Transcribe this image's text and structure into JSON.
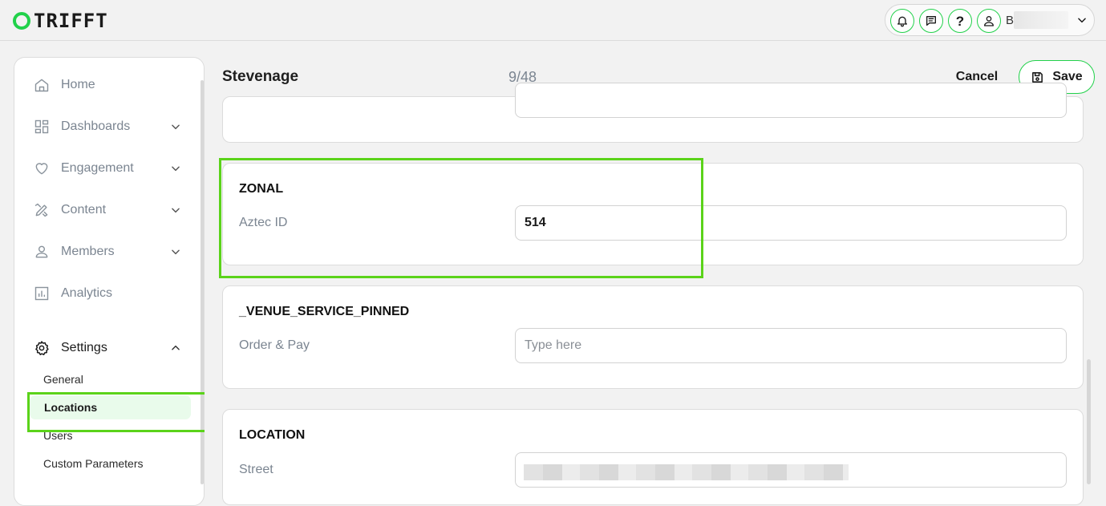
{
  "app": {
    "logo_text": "TRIFFT"
  },
  "header_tools": {
    "icons": [
      "bell-icon",
      "chat-icon",
      "help-icon",
      "user-icon",
      "chevron-down-icon"
    ],
    "help_glyph": "?",
    "user_initial": "B"
  },
  "sidebar": {
    "items": [
      {
        "label": "Home",
        "icon": "home-icon",
        "expandable": false
      },
      {
        "label": "Dashboards",
        "icon": "dashboard-icon",
        "expandable": true
      },
      {
        "label": "Engagement",
        "icon": "heart-icon",
        "expandable": true
      },
      {
        "label": "Content",
        "icon": "pencil-ruler-icon",
        "expandable": true
      },
      {
        "label": "Members",
        "icon": "person-icon",
        "expandable": true
      },
      {
        "label": "Analytics",
        "icon": "chart-icon",
        "expandable": false
      },
      {
        "label": "Settings",
        "icon": "gear-icon",
        "expandable": true,
        "expanded": true
      }
    ],
    "settings_sub": [
      "General",
      "Locations",
      "Users",
      "Custom Parameters"
    ],
    "selected_sub": "Locations"
  },
  "header": {
    "title": "Stevenage",
    "counter": "9/48",
    "cancel_label": "Cancel",
    "save_label": "Save"
  },
  "sections": [
    {
      "title": "ZONAL",
      "fields": [
        {
          "label": "Aztec ID",
          "value": "514",
          "placeholder": ""
        }
      ]
    },
    {
      "title": "_VENUE_SERVICE_PINNED",
      "fields": [
        {
          "label": "Order & Pay",
          "value": "",
          "placeholder": "Type here"
        }
      ]
    },
    {
      "title": "LOCATION",
      "fields": [
        {
          "label": "Street",
          "value": "",
          "placeholder": ""
        }
      ]
    }
  ],
  "colors": {
    "accent": "#21d14a",
    "highlight": "#5bd31a",
    "selected_bg": "#e9fbeb",
    "muted_text": "#7b8591"
  }
}
